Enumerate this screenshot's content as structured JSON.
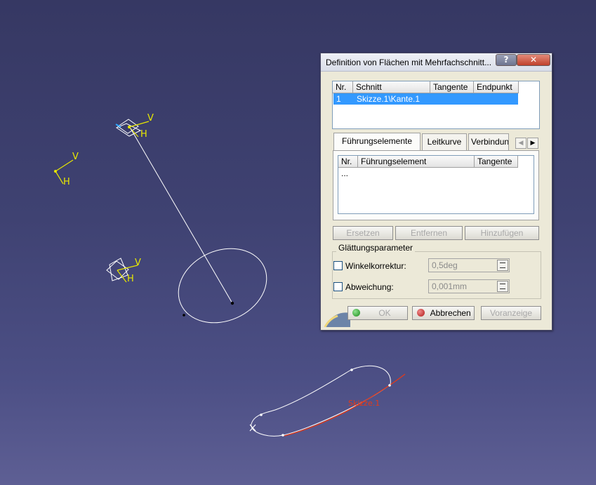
{
  "viewport": {
    "labels": {
      "axis_v": "V",
      "axis_h": "H",
      "curve_label": "Skizze.1"
    },
    "colors": {
      "axis": "#e8e800",
      "highlight_curve": "#e23a1a",
      "geometry": "#ffffff"
    }
  },
  "dialog": {
    "title": "Definition von Flächen mit Mehrfachschnitt...",
    "help_label": "?",
    "close_label": "✕",
    "sections_table": {
      "columns": [
        "Nr.",
        "Schnitt",
        "Tangente",
        "Endpunkt"
      ],
      "rows": [
        {
          "nr": "1",
          "schnitt": "Skizze.1\\Kante.1",
          "tangente": "",
          "endpunkt": ""
        }
      ]
    },
    "tabs": [
      "Führungselemente",
      "Leitkurve",
      "Verbindung"
    ],
    "active_tab": "Führungselemente",
    "guides_table": {
      "columns": [
        "Nr.",
        "Führungselement",
        "Tangente"
      ],
      "rows": [
        {
          "nr": "..."
        }
      ]
    },
    "buttons": {
      "ersetzen": "Ersetzen",
      "entfernen": "Entfernen",
      "hinzufuegen": "Hinzufügen"
    },
    "smoothing": {
      "title": "Glättungsparameter",
      "winkel_label": "Winkelkorrektur:",
      "winkel_value": "0,5deg",
      "abweichung_label": "Abweichung:",
      "abweichung_value": "0,001mm"
    },
    "footer": {
      "ok": "OK",
      "abbrechen": "Abbrechen",
      "voranzeige": "Voranzeige"
    }
  }
}
